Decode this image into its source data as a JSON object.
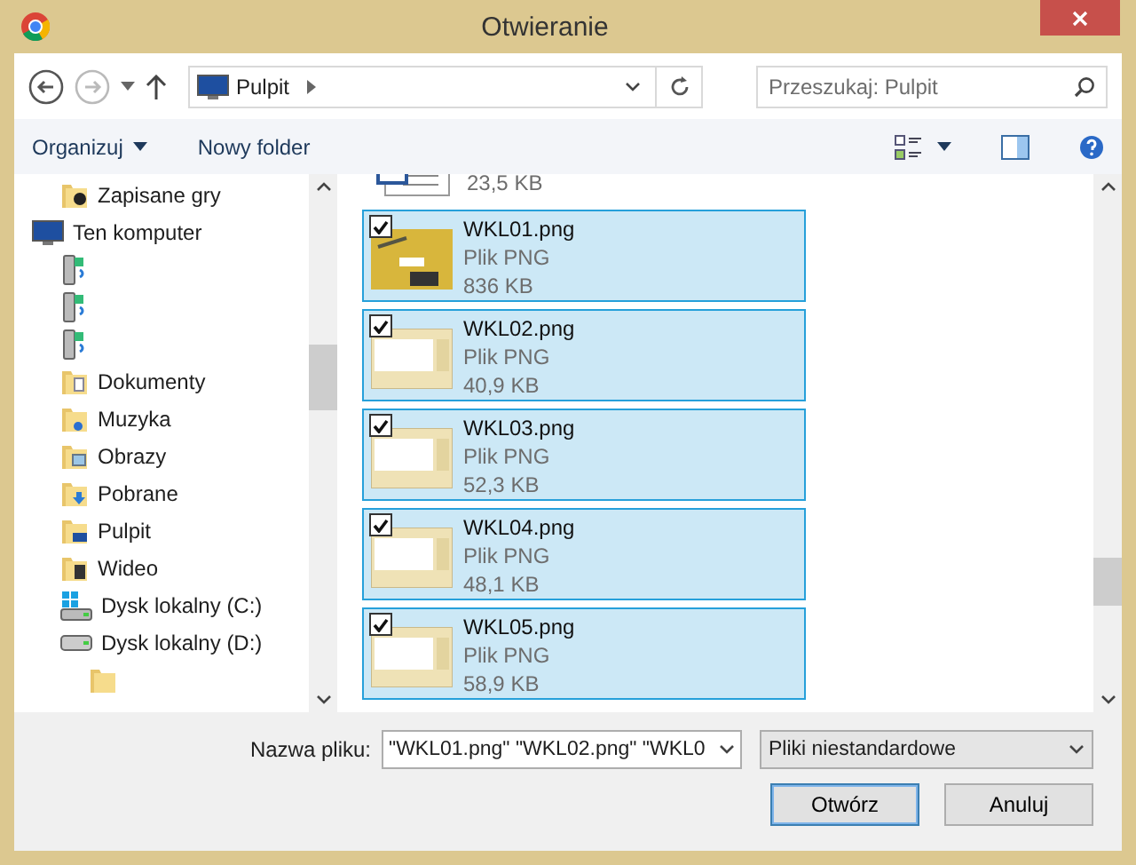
{
  "window": {
    "title": "Otwieranie"
  },
  "navigation": {
    "buttons": [
      {
        "kind": "back",
        "disabled": false
      },
      {
        "kind": "forward",
        "disabled": true
      },
      {
        "kind": "recent",
        "disabled": false
      },
      {
        "kind": "up",
        "disabled": false
      }
    ],
    "address": "Pulpit",
    "search": {
      "placeholder": "Przeszukaj: Pulpit"
    }
  },
  "toolbar": {
    "items": [
      {
        "label": "Organizuj",
        "kind": "menu"
      },
      {
        "label": "Nowy folder",
        "kind": "button"
      }
    ]
  },
  "tree": [
    {
      "label": "Zapisane gry",
      "kind": "games"
    },
    {
      "label": "Ten komputer",
      "kind": "computer",
      "children": [
        {
          "kind": "device"
        },
        {
          "kind": "device"
        },
        {
          "kind": "device"
        },
        {
          "label": "Dokumenty",
          "kind": "documents"
        },
        {
          "label": "Muzyka",
          "kind": "music"
        },
        {
          "label": "Obrazy",
          "kind": "pictures"
        },
        {
          "label": "Pobrane",
          "kind": "downloads"
        },
        {
          "label": "Pulpit",
          "kind": "desktop"
        },
        {
          "label": "Wideo",
          "kind": "video"
        },
        {
          "label": "Dysk lokalny (C:)",
          "kind": "system-drive"
        },
        {
          "label": "Dysk lokalny (D:)",
          "kind": "drive",
          "children": [
            {
              "kind": "folder"
            }
          ]
        }
      ]
    }
  ],
  "files": [
    {
      "kind": "document",
      "size": "23,5 KB",
      "selected": false
    },
    {
      "kind": "photo",
      "name": "WKL01.png",
      "type": "Plik PNG",
      "size": "836 KB",
      "selected": true,
      "checked": true
    },
    {
      "kind": "screenshot",
      "name": "WKL02.png",
      "type": "Plik PNG",
      "size": "40,9 KB",
      "selected": true,
      "checked": true
    },
    {
      "kind": "screenshot",
      "name": "WKL03.png",
      "type": "Plik PNG",
      "size": "52,3 KB",
      "selected": true,
      "checked": true
    },
    {
      "kind": "screenshot",
      "name": "WKL04.png",
      "type": "Plik PNG",
      "size": "48,1 KB",
      "selected": true,
      "checked": true
    },
    {
      "kind": "screenshot",
      "name": "WKL05.png",
      "type": "Plik PNG",
      "size": "58,9 KB",
      "selected": true,
      "checked": true
    }
  ],
  "footer": {
    "filename_label": "Nazwa pliku:",
    "filename": "\"WKL01.png\" \"WKL02.png\" \"WKL0",
    "filter": "Pliki niestandardowe",
    "buttons": [
      {
        "label": "Otwórz",
        "default": true
      },
      {
        "label": "Anuluj",
        "default": false
      }
    ]
  }
}
